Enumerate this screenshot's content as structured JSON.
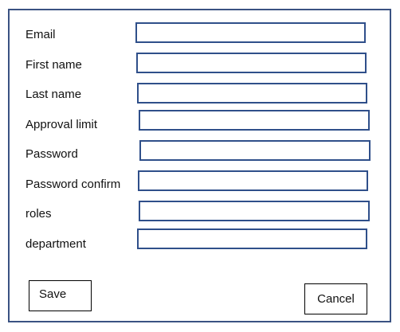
{
  "form": {
    "fields": [
      {
        "label": "Email",
        "value": ""
      },
      {
        "label": "First name",
        "value": ""
      },
      {
        "label": "Last name",
        "value": ""
      },
      {
        "label": "Approval limit",
        "value": ""
      },
      {
        "label": "Password",
        "value": ""
      },
      {
        "label": "Password confirm",
        "value": ""
      },
      {
        "label": "roles",
        "value": ""
      },
      {
        "label": "department",
        "value": ""
      }
    ],
    "save_label": "Save",
    "cancel_label": "Cancel"
  },
  "colors": {
    "frame_border": "#3a5282",
    "input_border": "#2f4f8a",
    "button_border": "#000000"
  }
}
